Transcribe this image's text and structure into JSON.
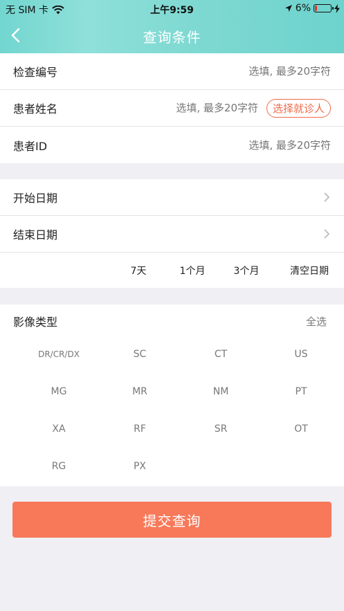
{
  "status": {
    "carrier": "无 SIM 卡",
    "time": "上午9:59",
    "battery": "6%"
  },
  "nav": {
    "title": "查询条件"
  },
  "fields": {
    "exam_no": {
      "label": "检查编号",
      "placeholder": "选填, 最多20字符"
    },
    "patient_name": {
      "label": "患者姓名",
      "placeholder": "选填, 最多20字符",
      "select_button": "选择就诊人"
    },
    "patient_id": {
      "label": "患者ID",
      "placeholder": "选填, 最多20字符"
    }
  },
  "dates": {
    "start_label": "开始日期",
    "end_label": "结束日期",
    "quick": [
      "7天",
      "1个月",
      "3个月",
      "清空日期"
    ]
  },
  "image_types": {
    "label": "影像类型",
    "select_all": "全选",
    "items": [
      "DR/CR/DX",
      "SC",
      "CT",
      "US",
      "MG",
      "MR",
      "NM",
      "PT",
      "XA",
      "RF",
      "SR",
      "OT",
      "RG",
      "PX"
    ]
  },
  "submit_label": "提交查询",
  "colors": {
    "header_teal": "#7fd9d2",
    "accent_orange": "#f77959",
    "select_button_red": "#f0694a",
    "background": "#efeff4"
  }
}
